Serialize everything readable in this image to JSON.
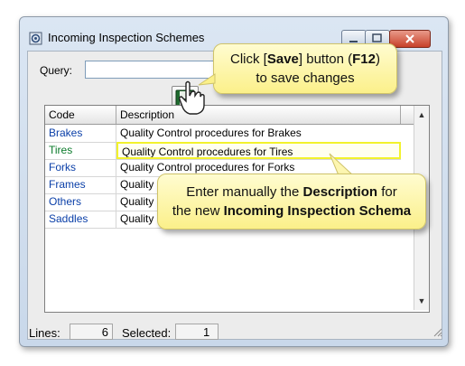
{
  "window": {
    "title": "Incoming Inspection Schemes"
  },
  "query": {
    "label": "Query:",
    "value": ""
  },
  "toolbar": {
    "save_icon": "floppy-disk-icon"
  },
  "grid": {
    "columns": [
      "Code",
      "Description"
    ],
    "rows": [
      {
        "code": "Brakes",
        "description": "Quality Control procedures for Brakes"
      },
      {
        "code": "Tires",
        "description": "Quality Control procedures for Tires"
      },
      {
        "code": "Forks",
        "description": "Quality Control procedures for Forks"
      },
      {
        "code": "Frames",
        "description": "Quality C"
      },
      {
        "code": "Others",
        "description": "Quality C"
      },
      {
        "code": "Saddles",
        "description": "Quality C"
      }
    ],
    "selected_row_index": 1
  },
  "status": {
    "lines_label": "Lines:",
    "lines_value": "6",
    "selected_label": "Selected:",
    "selected_value": "1"
  },
  "callouts": {
    "save": {
      "line1_pre": "Click [",
      "line1_bold": "Save",
      "line1_mid": "] button (",
      "line1_bold2": "F12",
      "line1_post": ")",
      "line2": "to save changes"
    },
    "description": {
      "line1_pre": "Enter manually the ",
      "line1_bold": "Description",
      "line1_post": " for",
      "line2_pre": "the new ",
      "line2_bold": "Incoming Inspection Schema"
    }
  },
  "colors": {
    "code_text": "#0a3fa8",
    "selected_code_text": "#0a7a2a",
    "highlight_border": "#f2f22c",
    "callout_fill": "#fbf08a"
  }
}
